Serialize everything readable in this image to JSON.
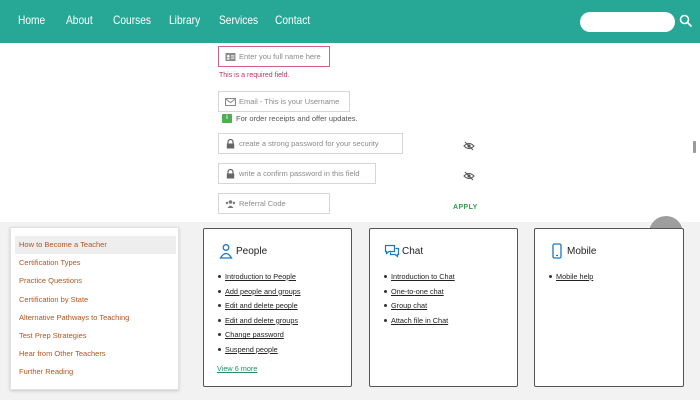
{
  "nav": {
    "items": [
      "Home",
      "About",
      "Courses",
      "Library",
      "Services",
      "Contact"
    ],
    "search_placeholder": ""
  },
  "form": {
    "name_placeholder": "Enter you full name here",
    "name_error": "This is a required field.",
    "email_placeholder": "Email - This is your Username",
    "email_hint": "For order receipts and offer updates.",
    "email_hint_badge": "i",
    "password_placeholder": "create a strong password for your security",
    "confirm_placeholder": "write a confirm password in this field",
    "referral_placeholder": "Referral Code",
    "apply_label": "APPLY"
  },
  "toc": {
    "items": [
      "How to Become a Teacher",
      "Certification Types",
      "Practice Questions",
      "Certification by State",
      "Alternative Pathways to Teaching",
      "Test Prep Strategies",
      "Hear from Other Teachers",
      "Further Reading"
    ],
    "active_index": 0
  },
  "cards": {
    "people": {
      "title": "People",
      "links": [
        "Introduction to People",
        "Add people and groups",
        "Edit and delete people",
        "Edit and delete groups",
        "Change password",
        "Suspend people"
      ],
      "view_more": "View 6 more"
    },
    "chat": {
      "title": "Chat",
      "links": [
        "Introduction to Chat",
        "One-to-one chat",
        "Group chat",
        "Attach file in Chat"
      ]
    },
    "mobile": {
      "title": "Mobile",
      "links": [
        "Mobile help"
      ]
    }
  },
  "colors": {
    "nav_bg": "#27a897",
    "error": "#c0335e",
    "apply": "#2fa04a",
    "toc_link": "#b5541e",
    "icon_blue": "#1a78c2"
  },
  "icons": [
    "search-icon",
    "id-card-icon",
    "envelope-icon",
    "lock-icon",
    "eye-slash-icon",
    "users-icon",
    "person-icon",
    "chat-bubbles-icon",
    "mobile-phone-icon"
  ]
}
